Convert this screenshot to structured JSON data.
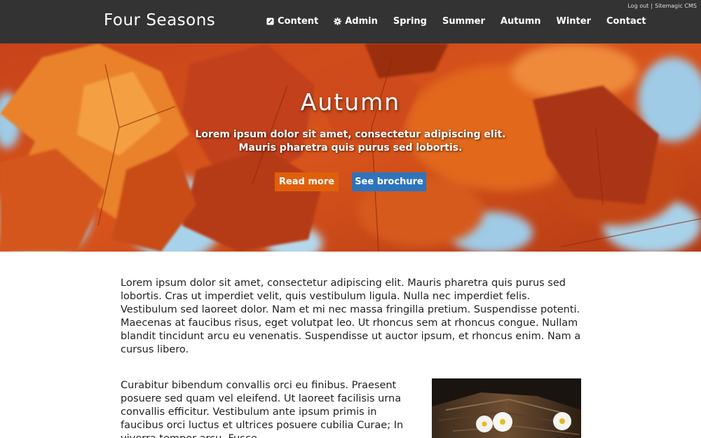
{
  "header": {
    "brand": "Four Seasons",
    "nav": [
      {
        "label": "Content",
        "icon": "edit-icon"
      },
      {
        "label": "Admin",
        "icon": "gear-icon"
      },
      {
        "label": "Spring"
      },
      {
        "label": "Summer"
      },
      {
        "label": "Autumn"
      },
      {
        "label": "Winter"
      },
      {
        "label": "Contact"
      }
    ],
    "user_links": {
      "logout": "Log out",
      "separator": "|",
      "cms": "Sitemagic CMS"
    }
  },
  "hero": {
    "title": "Autumn",
    "subtitle_line1": "Lorem ipsum dolor sit amet, consectetur adipiscing elit.",
    "subtitle_line2": "Mauris pharetra quis purus sed lobortis.",
    "read_more": "Read more",
    "see_brochure": "See brochure"
  },
  "content": {
    "paragraph1": "Lorem ipsum dolor sit amet, consectetur adipiscing elit. Mauris pharetra quis purus sed lobortis. Cras ut imperdiet velit, quis vestibulum ligula. Nulla nec imperdiet felis. Vestibulum sed laoreet dolor. Nam et mi nec massa fringilla pretium. Suspendisse potenti. Maecenas at faucibus risus, eget volutpat leo. Ut rhoncus sem at rhoncus congue. Nullam blandit tincidunt arcu eu venenatis. Suspendisse ut auctor ipsum, et rhoncus enim. Nam a cursus libero.",
    "paragraph2": "Curabitur bibendum convallis orci eu finibus. Praesent posuere sed quam vel eleifend. Ut laoreet facilisis urna convallis efficitur. Vestibulum ante ipsum primis in faucibus orci luctus et ultrices posuere cubilia Curae; In viverra tempor arcu. Fusce"
  },
  "colors": {
    "topbar": "#333333",
    "read_more_button": "#e05f0b",
    "brochure_button": "#2e73bd"
  }
}
